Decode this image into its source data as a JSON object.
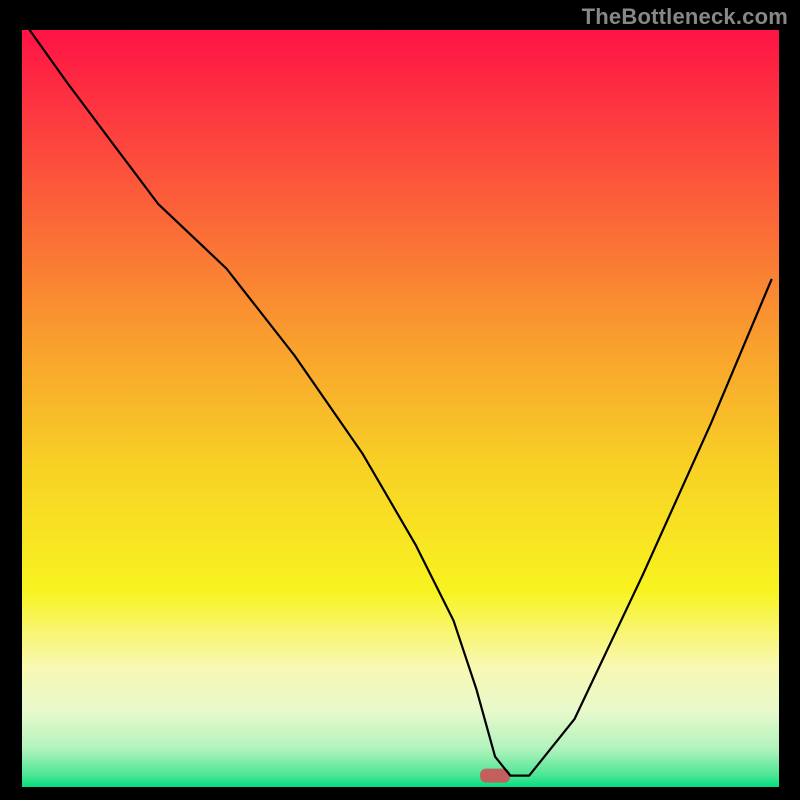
{
  "attribution": "TheBottleneck.com",
  "chart_data": {
    "type": "line",
    "title": "",
    "xlabel": "",
    "ylabel": "",
    "xlim": [
      0,
      100
    ],
    "ylim": [
      0,
      100
    ],
    "background": {
      "description": "vertical gradient from red (top) through orange/yellow to pale-green / green (bottom)",
      "stops": [
        {
          "offset": 0.0,
          "color": "#fe1345"
        },
        {
          "offset": 0.18,
          "color": "#fc4f3c"
        },
        {
          "offset": 0.4,
          "color": "#f99b2f"
        },
        {
          "offset": 0.58,
          "color": "#f8d225"
        },
        {
          "offset": 0.74,
          "color": "#f8f320"
        },
        {
          "offset": 0.84,
          "color": "#f8f8b2"
        },
        {
          "offset": 0.9,
          "color": "#e8f9cc"
        },
        {
          "offset": 0.95,
          "color": "#b0f3bc"
        },
        {
          "offset": 0.985,
          "color": "#4be594"
        },
        {
          "offset": 1.0,
          "color": "#02e07f"
        }
      ]
    },
    "marker": {
      "x_fraction": 0.625,
      "y_fraction": 0.985,
      "color": "#c1605d",
      "shape": "rounded-rect"
    },
    "series": [
      {
        "name": "curve",
        "x": [
          1,
          6,
          12,
          18,
          27,
          36,
          45,
          52,
          57,
          60,
          62.5,
          64.5,
          67,
          73,
          82,
          91,
          99
        ],
        "y": [
          100,
          93,
          85,
          77,
          68.5,
          57,
          44,
          32,
          22,
          13,
          4,
          1.5,
          1.5,
          9,
          28,
          48,
          67
        ]
      }
    ]
  }
}
